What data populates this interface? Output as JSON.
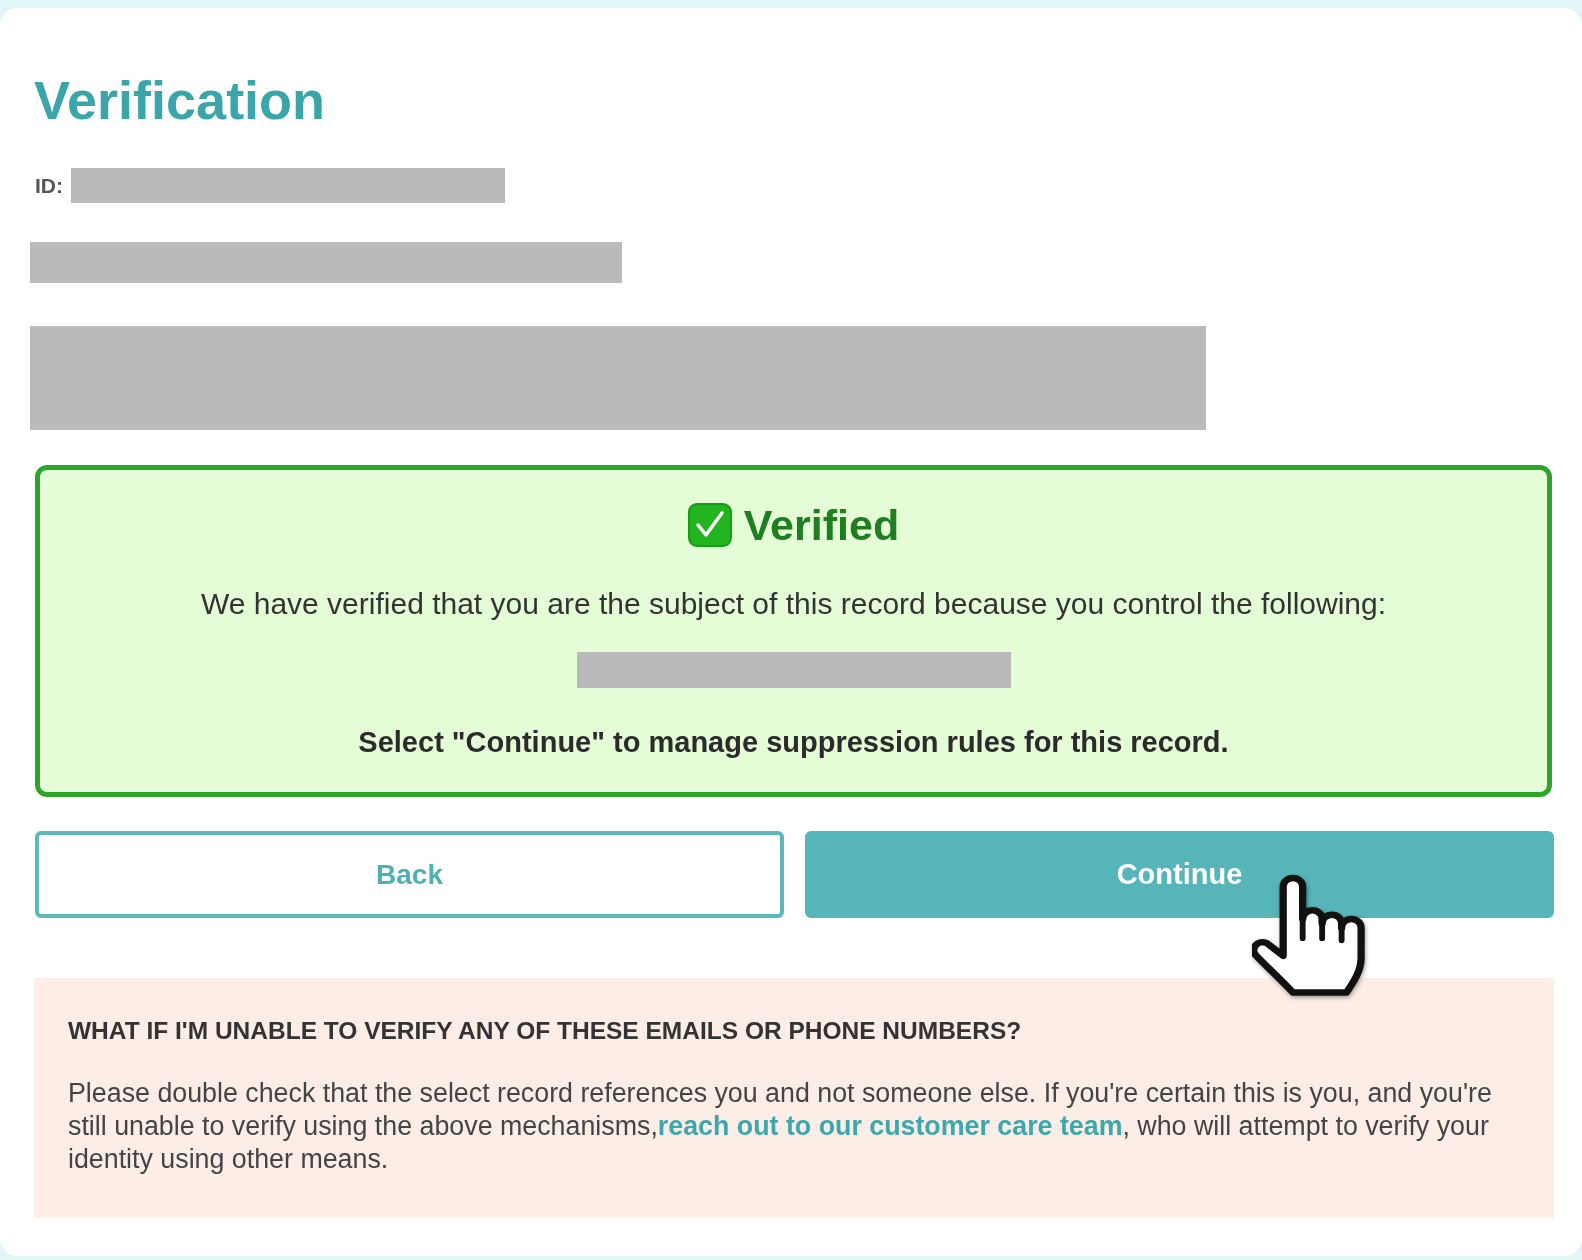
{
  "page": {
    "title": "Verification"
  },
  "record": {
    "id_label": "ID:"
  },
  "verification": {
    "title": "Verified",
    "message": "We have verified that you are the subject of this record because you control the following:",
    "instruction": "Select \"Continue\" to manage suppression rules for this record."
  },
  "buttons": [
    {
      "label": "Back",
      "kind": "secondary"
    },
    {
      "label": "Continue",
      "kind": "primary"
    }
  ],
  "help": {
    "heading": "WHAT IF I'M UNABLE TO VERIFY ANY OF THESE EMAILS OR PHONE NUMBERS?",
    "text_before": "Please double check that the select record references you and not someone else. If you're certain this is you, and you're still unable to verify using the above mechanisms,",
    "link": "reach out to our customer care team",
    "text_after": ", who will attempt to verify your identity using other means."
  }
}
